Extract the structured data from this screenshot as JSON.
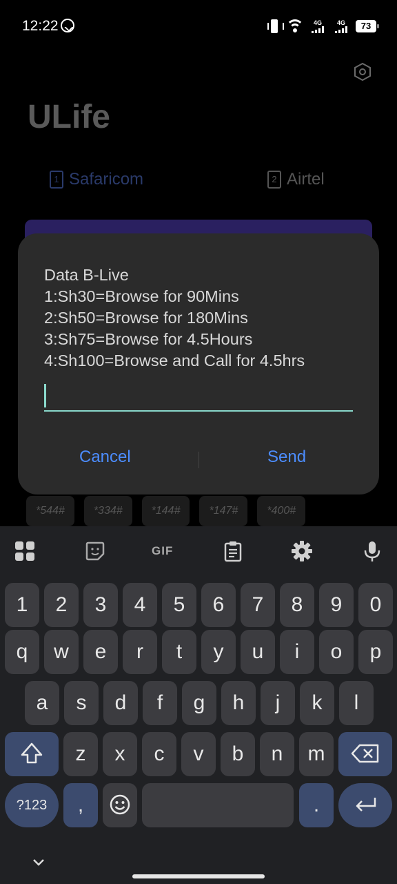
{
  "status_bar": {
    "time": "12:22",
    "network_1": "4G",
    "network_2": "4G",
    "battery": "73"
  },
  "app": {
    "title": "ULife",
    "tabs": [
      {
        "label": "Safaricom",
        "sim": "1"
      },
      {
        "label": "Airtel",
        "sim": "2"
      }
    ],
    "codes": [
      "*544#",
      "*334#",
      "*144#",
      "*147#",
      "*400#"
    ]
  },
  "dialog": {
    "message_lines": [
      "Data B-Live",
      "1:Sh30=Browse for 90Mins",
      "2:Sh50=Browse for 180Mins",
      "3:Sh75=Browse for 4.5Hours",
      "4:Sh100=Browse and Call for 4.5hrs"
    ],
    "input_value": "",
    "cancel_label": "Cancel",
    "send_label": "Send"
  },
  "keyboard": {
    "toolbar": {
      "gif_label": "GIF"
    },
    "row_numbers": [
      "1",
      "2",
      "3",
      "4",
      "5",
      "6",
      "7",
      "8",
      "9",
      "0"
    ],
    "row_1": [
      "q",
      "w",
      "e",
      "r",
      "t",
      "y",
      "u",
      "i",
      "o",
      "p"
    ],
    "row_2": [
      "a",
      "s",
      "d",
      "f",
      "g",
      "h",
      "j",
      "k",
      "l"
    ],
    "row_3": [
      "z",
      "x",
      "c",
      "v",
      "b",
      "n",
      "m"
    ],
    "symbols_label": "?123",
    "comma_label": ",",
    "period_label": "."
  },
  "colors": {
    "accent_button": "#4c8dff",
    "input_underline": "#8ad9cc",
    "dialog_bg": "#2b2b2b",
    "keyboard_bg": "#202124"
  }
}
